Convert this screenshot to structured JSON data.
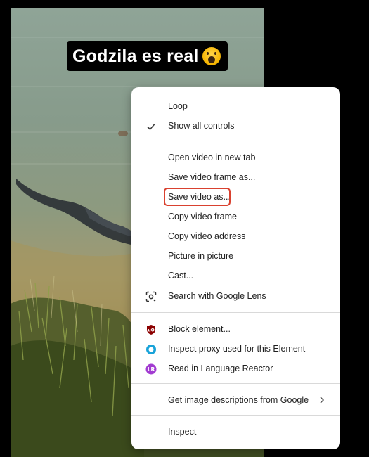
{
  "video": {
    "caption": "Godzila es real"
  },
  "menu": {
    "loop": "Loop",
    "show_all_controls": "Show all controls",
    "open_in_new_tab": "Open video in new tab",
    "save_frame": "Save video frame as...",
    "save_video": "Save video as...",
    "copy_frame": "Copy video frame",
    "copy_address": "Copy video address",
    "pip": "Picture in picture",
    "cast": "Cast...",
    "google_lens": "Search with Google Lens",
    "block_element": "Block element...",
    "inspect_proxy": "Inspect proxy used for this Element",
    "language_reactor": "Read in Language Reactor",
    "image_descriptions": "Get image descriptions from Google",
    "inspect": "Inspect"
  },
  "colors": {
    "highlight_border": "#d9412f",
    "ublock_red": "#8b0000",
    "proxy_blue": "#19a3d9",
    "language_reactor_purple": "#a23bd1"
  },
  "icons": {
    "check": "check-icon",
    "lens": "google-lens-icon",
    "ublock": "ublock-origin-icon",
    "proxy": "proxy-circle-icon",
    "language_reactor": "language-reactor-icon",
    "submenu": "chevron-right-icon"
  }
}
